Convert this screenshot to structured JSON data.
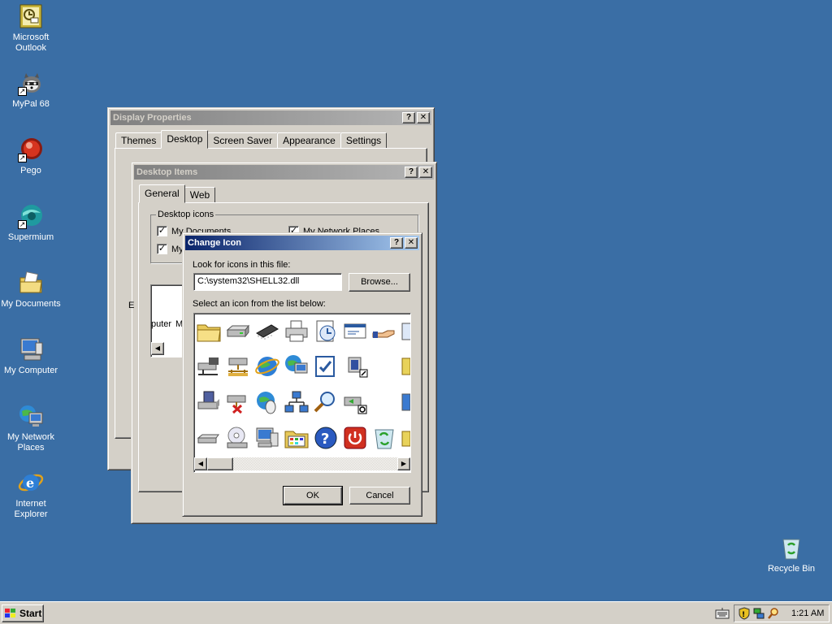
{
  "desktop": {
    "icons": [
      {
        "label": "Microsoft\nOutlook",
        "icon": "outlook-icon"
      },
      {
        "label": "MyPal 68",
        "icon": "mypal-icon"
      },
      {
        "label": "Pego",
        "icon": "pego-icon"
      },
      {
        "label": "Supermium",
        "icon": "supermium-icon"
      },
      {
        "label": "My Documents",
        "icon": "my-documents-icon"
      },
      {
        "label": "My Computer",
        "icon": "my-computer-icon"
      },
      {
        "label": "My Network\nPlaces",
        "icon": "network-places-icon"
      },
      {
        "label": "Internet\nExplorer",
        "icon": "internet-explorer-icon"
      },
      {
        "label": "Recycle Bin",
        "icon": "recycle-bin-icon"
      }
    ]
  },
  "display_properties": {
    "title": "Display Properties",
    "tabs": [
      "Themes",
      "Desktop",
      "Screen Saver",
      "Appearance",
      "Settings"
    ],
    "selected_tab": "Desktop"
  },
  "desktop_items": {
    "title": "Desktop Items",
    "tabs": [
      "General",
      "Web"
    ],
    "group_label": "Desktop icons",
    "checkboxes": [
      {
        "label": "My Documents",
        "checked": true
      },
      {
        "label": "My Network Places",
        "checked": true
      },
      {
        "label": "My",
        "checked": true
      }
    ],
    "list_fragments": [
      "puter",
      "M"
    ],
    "side_letter": "E"
  },
  "change_icon": {
    "title": "Change Icon",
    "look_label": "Look for icons in this file:",
    "file_value": "C:\\system32\\SHELL32.dll",
    "browse_label": "Browse...",
    "select_label": "Select an icon from the list below:",
    "ok_label": "OK",
    "cancel_label": "Cancel",
    "help_glyph": "?",
    "close_glyph": "✕"
  },
  "taskbar": {
    "start_label": "Start",
    "clock": "1:21 AM"
  },
  "colors": {
    "desktop": "#3a6ea5",
    "title_active": "#0a246a",
    "title_inactive": "#808080"
  }
}
